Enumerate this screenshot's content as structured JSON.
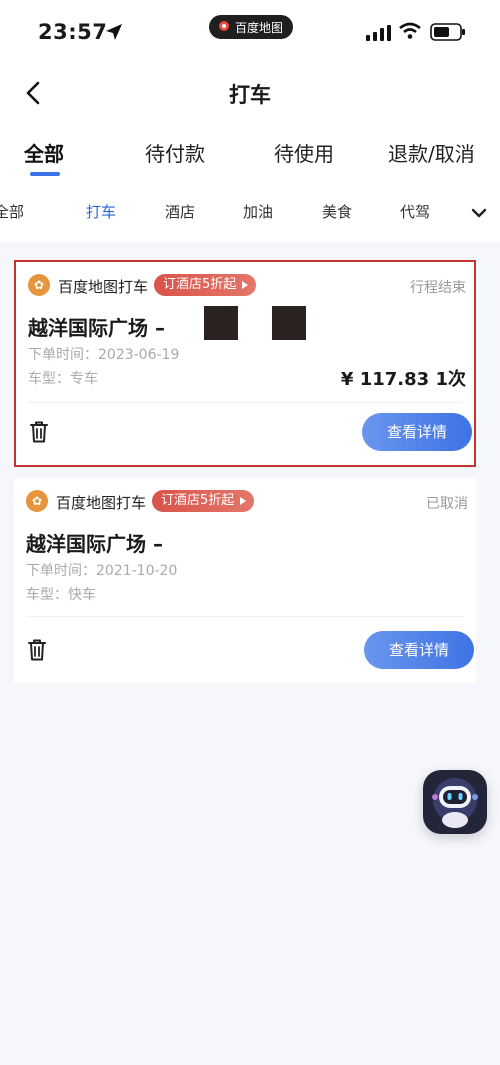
{
  "status_bar": {
    "time": "23:57",
    "app_pill": "百度地图",
    "icons": [
      "location-arrow-icon",
      "signal-icon",
      "wifi-icon",
      "battery-icon"
    ]
  },
  "header": {
    "title": "打车",
    "back_icon": "chevron-left-icon"
  },
  "tabs": [
    {
      "label": "全部",
      "active": true
    },
    {
      "label": "待付款",
      "active": false
    },
    {
      "label": "待使用",
      "active": false
    },
    {
      "label": "退款/取消",
      "active": false
    }
  ],
  "categories": [
    {
      "label": "全部"
    },
    {
      "label": "打车",
      "active": true
    },
    {
      "label": "酒店"
    },
    {
      "label": "加油"
    },
    {
      "label": "美食"
    },
    {
      "label": "代驾"
    }
  ],
  "orders": [
    {
      "brand": "百度地图打车",
      "promo": "订酒店5折起",
      "status": "行程结束",
      "route": "越洋国际广场 –",
      "order_time_label": "下单时间：",
      "order_time": "2023-06-19",
      "car_type_label": "车型：",
      "car_type": "专车",
      "price": "¥ 117.83",
      "count": "1次",
      "detail_label": "查看详情"
    },
    {
      "brand": "百度地图打车",
      "promo": "订酒店5折起",
      "status": "已取消",
      "route": "越洋国际广场 –",
      "order_time_label": "下单时间：",
      "order_time": "2021-10-20",
      "car_type_label": "车型：",
      "car_type": "快车",
      "detail_label": "查看详情"
    }
  ],
  "colors": {
    "accent": "#3b73e8",
    "brand_badge": "#e6953c",
    "promo": "#d9534a",
    "highlight_border": "#c43232"
  }
}
